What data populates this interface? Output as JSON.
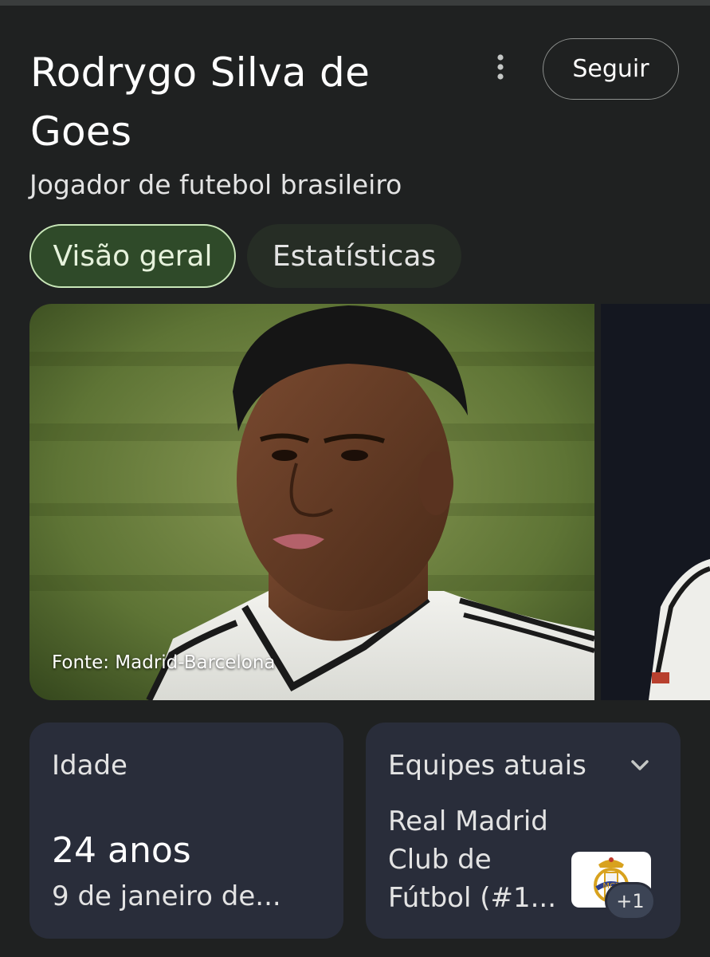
{
  "header": {
    "title_line1": "Rodrygo Silva de",
    "title_line2": "Goes",
    "subtitle": "Jogador de futebol brasileiro",
    "follow_label": "Seguir",
    "more_icon": "more-vert-icon"
  },
  "tabs": [
    {
      "label": "Visão geral",
      "active": true
    },
    {
      "label": "Estatísticas",
      "active": false
    }
  ],
  "gallery": {
    "main_caption": "Fonte: Madrid-Barcelona"
  },
  "cards": {
    "age": {
      "label": "Idade",
      "value": "24 anos",
      "birth": "9 de janeiro de..."
    },
    "teams": {
      "label": "Equipes atuais",
      "name_line1": "Real Madrid",
      "name_line2": "Club de",
      "name_line3": "Fútbol (#1...",
      "more_count": "+1",
      "crest_icon": "real-madrid-crest-icon",
      "expand_icon": "chevron-down-icon"
    }
  },
  "colors": {
    "background": "#1f2121",
    "tab_active_bg": "#2f4a29",
    "tab_active_border": "#c8e6b8",
    "card_bg": "#292d3a"
  }
}
